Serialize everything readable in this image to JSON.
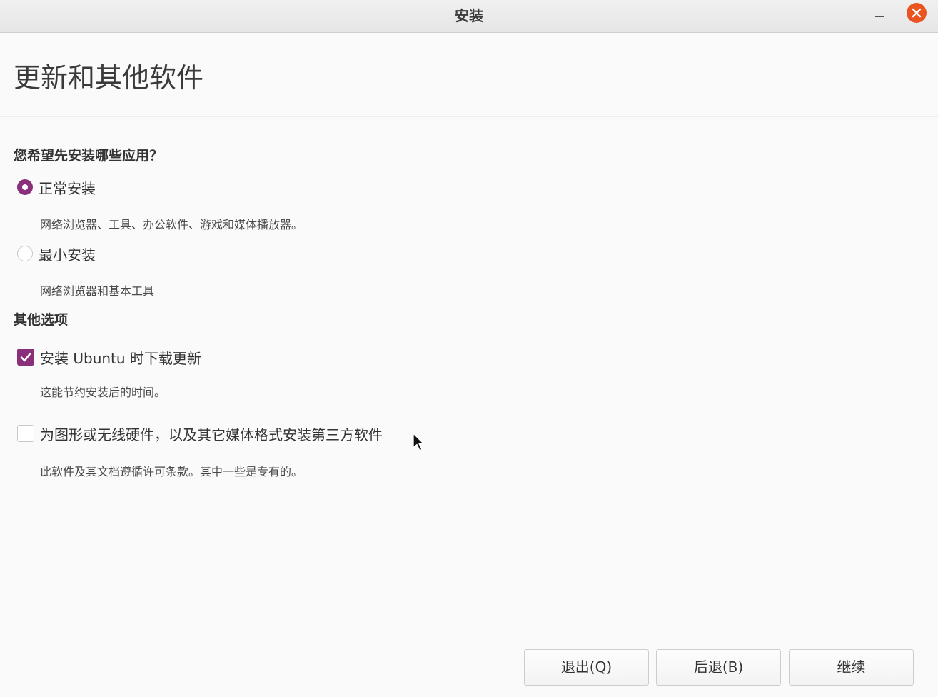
{
  "window": {
    "title": "安装"
  },
  "page": {
    "title": "更新和其他软件"
  },
  "install_type": {
    "question": "您希望先安装哪些应用？",
    "options": [
      {
        "label": "正常安装",
        "description": "网络浏览器、工具、办公软件、游戏和媒体播放器。",
        "selected": true
      },
      {
        "label": "最小安装",
        "description": "网络浏览器和基本工具",
        "selected": false
      }
    ]
  },
  "other_options": {
    "heading": "其他选项",
    "items": [
      {
        "label": "安装 Ubuntu 时下载更新",
        "description": "这能节约安装后的时间。",
        "checked": true
      },
      {
        "label": "为图形或无线硬件，以及其它媒体格式安装第三方软件",
        "description": "此软件及其文档遵循许可条款。其中一些是专有的。",
        "checked": false
      }
    ]
  },
  "buttons": {
    "quit": "退出(Q)",
    "back": "后退(B)",
    "continue": "继续"
  },
  "colors": {
    "accent": "#8a2f79",
    "close": "#e95420"
  },
  "icons": {
    "minimize": "minimize-icon",
    "close": "close-icon",
    "check": "checkmark-icon",
    "cursor": "mouse-pointer-icon"
  }
}
